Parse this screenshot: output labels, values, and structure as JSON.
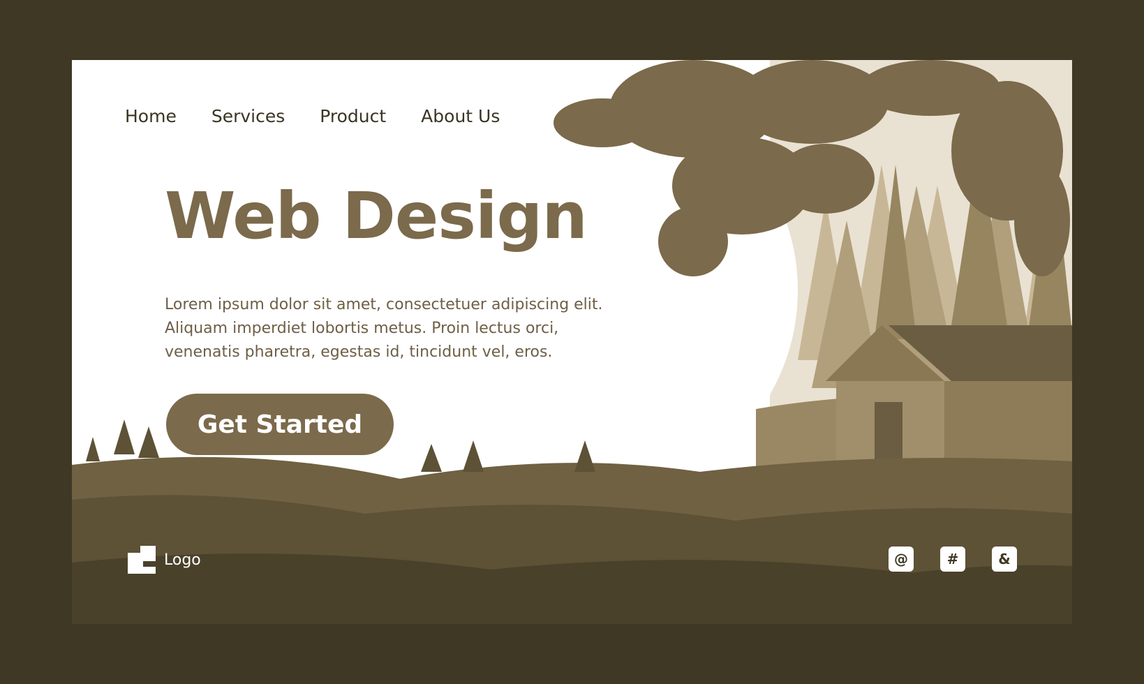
{
  "nav": {
    "items": [
      {
        "label": "Home"
      },
      {
        "label": "Services"
      },
      {
        "label": "Product"
      },
      {
        "label": "About Us"
      }
    ]
  },
  "hero": {
    "title": "Web Design",
    "description": "Lorem ipsum dolor sit amet, consectetuer adipiscing elit. Aliquam imperdiet lobortis metus. Proin lectus orci, venenatis pharetra, egestas id, tincidunt vel, eros.",
    "cta_label": "Get Started"
  },
  "footer": {
    "logo_text": "Logo",
    "social": [
      {
        "glyph": "@",
        "icon": "at-icon"
      },
      {
        "glyph": "#",
        "icon": "hash-icon"
      },
      {
        "glyph": "&",
        "icon": "ampersand-icon"
      }
    ]
  },
  "colors": {
    "outer_background": "#3f3824",
    "accent": "#7b6a4b",
    "text_dark": "#3a3423"
  }
}
